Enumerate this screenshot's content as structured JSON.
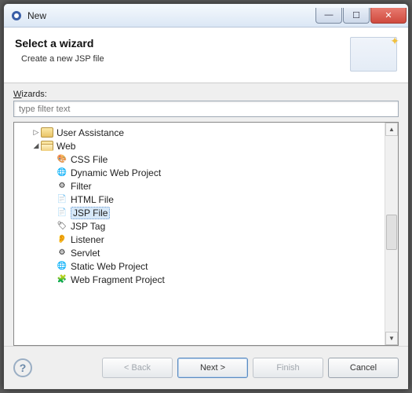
{
  "window": {
    "title": "New"
  },
  "header": {
    "title": "Select a wizard",
    "subtitle": "Create a new JSP file"
  },
  "wizards_label_prefix": "W",
  "wizards_label_rest": "izards:",
  "filter_placeholder": "type filter text",
  "tree": {
    "user_assistance": "User Assistance",
    "web": "Web",
    "items": [
      "CSS File",
      "Dynamic Web Project",
      "Filter",
      "HTML File",
      "JSP File",
      "JSP Tag",
      "Listener",
      "Servlet",
      "Static Web Project",
      "Web Fragment Project"
    ],
    "selected_index": 4
  },
  "buttons": {
    "back": "< Back",
    "next": "Next >",
    "finish": "Finish",
    "cancel": "Cancel"
  },
  "icons": [
    "🎨",
    "🌐",
    "⚙",
    "📄",
    "📄",
    "🏷",
    "👂",
    "⚙",
    "🌐",
    "🧩"
  ]
}
